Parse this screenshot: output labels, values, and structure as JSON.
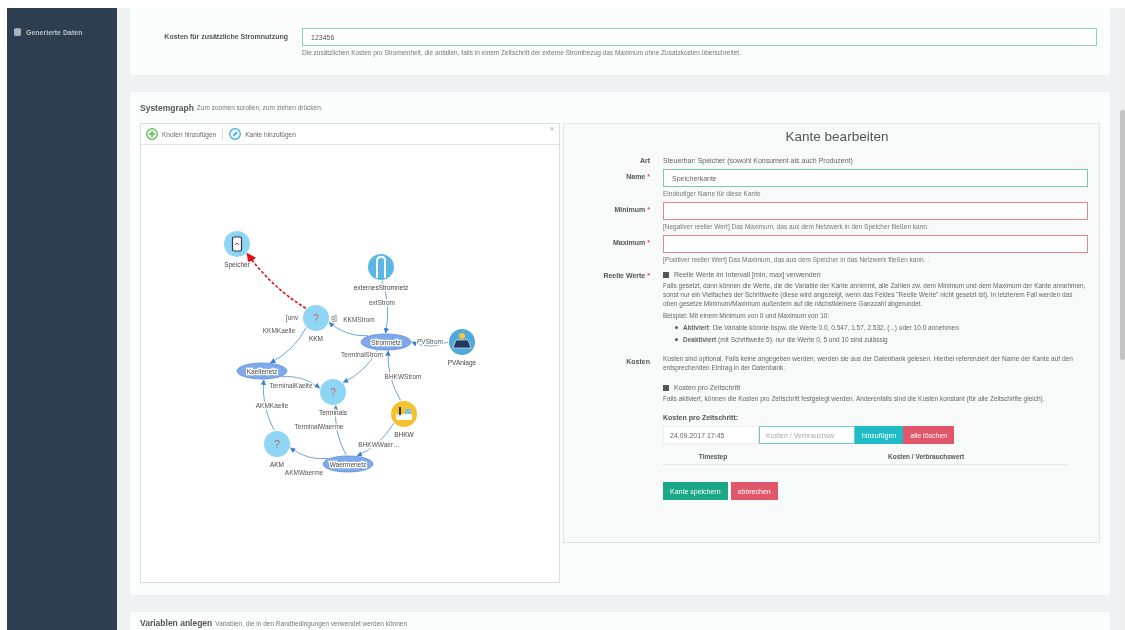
{
  "sidebar": {
    "items": [
      {
        "label": "Generierte Daten",
        "selected": false
      }
    ]
  },
  "cost_card": {
    "label": "Kosten für zusätzliche Stromnutzung",
    "value": "123456",
    "help": "Die zusätzlichen Kosten pro Stromeinheit, die anfallen, falls in einem Zeitschritt der externe Strombezug das Maximum ohne Zusatzkosten überschreitet."
  },
  "systemgraph": {
    "title": "Systemgraph",
    "hint": "Zum zoomen scrollen, zum ziehen drücken.",
    "toolbar": {
      "buttons": [
        {
          "label": "Knoten hinzufügen",
          "kind": "add-node"
        },
        {
          "label": "Kante hinzufügen",
          "kind": "add-edge"
        }
      ],
      "close": "×"
    },
    "nodes": [
      {
        "label": "Speicher",
        "kind": "storage"
      },
      {
        "label": "externesStromnetz",
        "kind": "grid"
      },
      {
        "label": "KKM",
        "kind": "question",
        "symbol": "?"
      },
      {
        "label": "Stromnetz",
        "kind": "network"
      },
      {
        "label": "PVAnlage",
        "kind": "solar"
      },
      {
        "label": "Kaeltenetz",
        "kind": "network"
      },
      {
        "label": "Terminals",
        "kind": "question",
        "symbol": "?"
      },
      {
        "label": "BHKW",
        "kind": "chp"
      },
      {
        "label": "AKM",
        "kind": "question",
        "symbol": "?"
      },
      {
        "label": "Waermenetz",
        "kind": "network"
      }
    ],
    "edges": [
      {
        "labels": [
          "[unv",
          "g]"
        ],
        "selected": true
      },
      {
        "labels": [
          "extStrom"
        ],
        "selected": false
      },
      {
        "labels": [
          "KKMKaelte"
        ],
        "selected": false
      },
      {
        "labels": [
          "KKMStrom"
        ],
        "selected": false
      },
      {
        "labels": [
          "PVStrom"
        ],
        "selected": false
      },
      {
        "labels": [
          "TerminalStrom"
        ],
        "selected": false
      },
      {
        "labels": [
          "TerminalKaelte"
        ],
        "selected": false
      },
      {
        "labels": [
          "BHKWStrom"
        ],
        "selected": false
      },
      {
        "labels": [
          "AKMKaelte"
        ],
        "selected": false
      },
      {
        "labels": [
          "TerminalWaerme"
        ],
        "selected": false
      },
      {
        "labels": [
          "BHKWWaer…"
        ],
        "selected": false
      },
      {
        "labels": [
          "AKMWaerme"
        ],
        "selected": false
      }
    ]
  },
  "edit_panel": {
    "title": "Kante bearbeiten",
    "art": {
      "label": "Art",
      "value": "Steuerbar: Speicher (sowohl Konsument als auch Produzent)"
    },
    "required_mark": "*",
    "fields": [
      {
        "label": "Name",
        "required": true,
        "value": "Speicherkante",
        "valid": true,
        "help": "Eindeutiger Name für diese Kante"
      },
      {
        "label": "Minimum",
        "required": true,
        "valid": false,
        "help": "[Negativer reeller Wert] Das Maximum, das aus dem Netzwerk in den Speicher fließen kann."
      },
      {
        "label": "Maximum",
        "required": true,
        "valid": false,
        "help": "[Positiver reeller Wert] Das Maximum, das aus dem Speicher in das Netzwerk fließen kann. ."
      }
    ],
    "real_values": {
      "label": "Reelle Werte",
      "required": true,
      "checkbox": {
        "label": "Reelle Werte im Intervall [min, max] verwenden",
        "checked": true
      },
      "description": "Falls gesetzt, dann können die Werte, die die Variable der Kante annimmt, alle Zahlen zw. dem Minimum und dem Maximum der Kante annehmen, sonst nur ein Vielfaches der Schrittweite (diese wird angezeigt, wenn das Feldes \"Reelle Werte\" nicht gesetzt ist). In letzterem Fall werden das oben gesetze Minimum/Maximum außerdem auf die nächstkleinere Ganzzahl abgerundet.",
      "example": "Beispiel: Mit einem Minimum von 0 und Maximum von 10:",
      "bullets": [
        "**Aktiviert**: Die Variable könnte bspw. die Werte 0.0, 0.547, 1.57, 2.532, (...) oder 10.0 annehmen",
        "**Deaktiviert** (mit Schrittweite 5): nur die Werte 0, 5 und 10 sind zulässig"
      ]
    },
    "costs": {
      "label": "Kosten",
      "description": "Kosten sind optional. Falls keine angegeben werden, werden sie aus der Datenbank gelesen. Hierbei referenziert der Name der Kante auf den entsprechenden Eintrag in der Datenbank.",
      "checkbox": {
        "label": "Kosten pro Zeitschritt",
        "checked": true
      },
      "checkbox_help": "Falls aktiviert, können die Kosten pro Zeitschritt festgelegt werden. Anderenfalls sind die Kosten konstant (für alle Zeitschritte gleich).",
      "per_step_title": "Kosten pro Zeitschritt:",
      "date": "24.09.2017 17:45",
      "value_placeholder": "Kosten / Verbrauchsw",
      "add": "hinzufügen",
      "clear": "alle löschen",
      "columns": [
        "Timestep",
        "Kosten / Verbrauchswert"
      ]
    },
    "buttons": [
      {
        "label": "Kante speichern",
        "kind": "primary"
      },
      {
        "label": "abbrechen",
        "kind": "danger"
      }
    ]
  },
  "variables_card": {
    "title": "Variablen anlegen",
    "hint": "Variablen, die in den Randbedingungen verwendet werden können"
  }
}
